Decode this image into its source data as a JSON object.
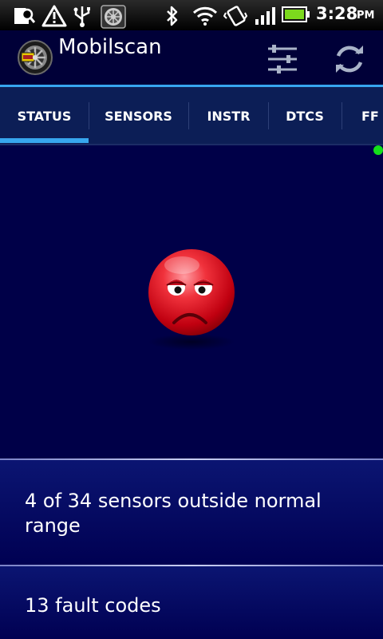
{
  "status_bar": {
    "icons": [
      "sd-card-scan-icon",
      "warning-icon",
      "usb-icon",
      "app-notification-icon",
      "bluetooth-icon",
      "wifi-icon",
      "vibrate-icon",
      "signal-icon",
      "battery-icon"
    ],
    "time": "3:28",
    "ampm": "PM"
  },
  "action_bar": {
    "title": "Mobilscan",
    "icons": [
      "app-logo-icon",
      "settings-sliders-icon",
      "refresh-icon"
    ]
  },
  "tabs": [
    {
      "label": "STATUS",
      "selected": true
    },
    {
      "label": "SENSORS",
      "selected": false
    },
    {
      "label": "INSTR",
      "selected": false
    },
    {
      "label": "DTCS",
      "selected": false
    },
    {
      "label": "FF",
      "selected": false
    }
  ],
  "status": {
    "indicator_color": "#14e01a",
    "face": "sad-face-icon",
    "face_color": "#e8202a",
    "sensors_message": "4 of 34 sensors outside normal range",
    "fault_message": "13 fault codes"
  },
  "colors": {
    "accent": "#37a6ee",
    "background": "#000048"
  }
}
